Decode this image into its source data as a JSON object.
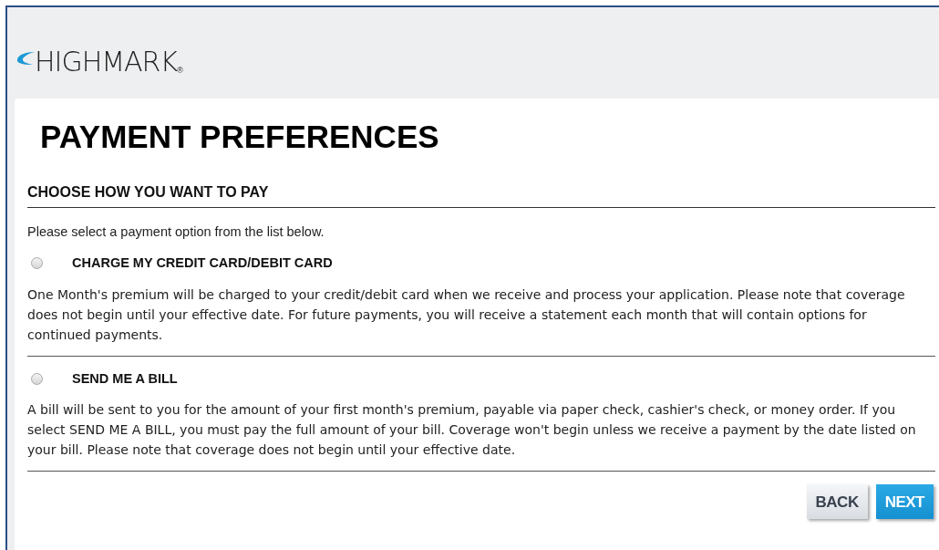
{
  "logo": {
    "wordmark": "HIGHMARK",
    "registered": "®"
  },
  "page_title": "PAYMENT PREFERENCES",
  "section": {
    "heading": "CHOOSE HOW YOU WANT TO PAY",
    "instruction": "Please select a payment option from the list below."
  },
  "options": [
    {
      "label": "CHARGE MY CREDIT CARD/DEBIT CARD",
      "selected": false,
      "description": "One Month's premium will be charged to your credit/debit card when we receive and process your application. Please note that coverage does not begin until your effective date. For future payments, you will receive a statement each month that will contain options for continued payments."
    },
    {
      "label": "SEND ME A BILL",
      "selected": false,
      "description": "A bill will be sent to you for the amount of your first month's premium, payable via paper check, cashier's check, or money order. If you select SEND ME A BILL, you must pay the full amount of your bill. Coverage won't begin unless we receive a payment by the date listed on your bill. Please note that coverage does not begin until your effective date."
    }
  ],
  "buttons": [
    {
      "label": "BACK",
      "kind": "secondary"
    },
    {
      "label": "NEXT",
      "kind": "primary"
    }
  ]
}
